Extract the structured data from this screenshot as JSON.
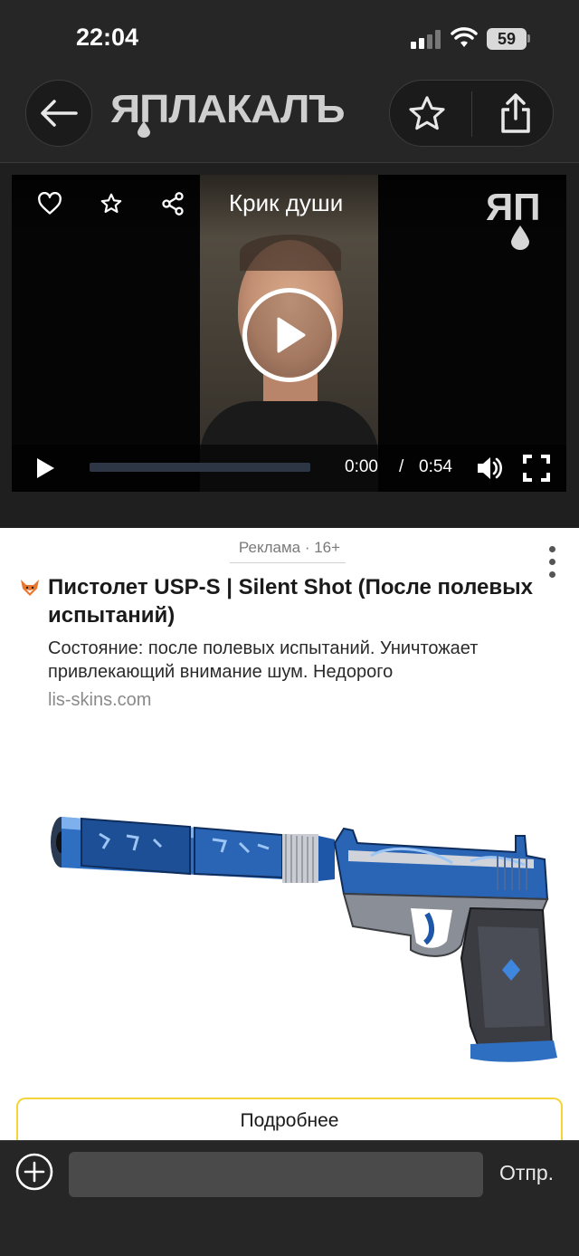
{
  "status_bar": {
    "time": "22:04",
    "battery": "59"
  },
  "header": {
    "logo_text": "ЯПЛАКАЛЪ"
  },
  "video": {
    "title": "Крик души",
    "watermark": "ЯП",
    "current_time": "0:00",
    "separator": "/",
    "duration": "0:54",
    "progress": 0
  },
  "ad": {
    "label": "Реклама · 16+",
    "title": "Пистолет USP-S | Silent Shot (После полевых испытаний)",
    "description": "Состояние: после полевых испытаний. Уничтожает привлекающий внимание шум. Недорого",
    "domain": "lis-skins.com",
    "cta": "Подробнее"
  },
  "composer": {
    "placeholder": "",
    "send_label": "Отпр."
  },
  "colors": {
    "accent_ad_border": "#f5d33b",
    "bar_bg": "#262626"
  }
}
